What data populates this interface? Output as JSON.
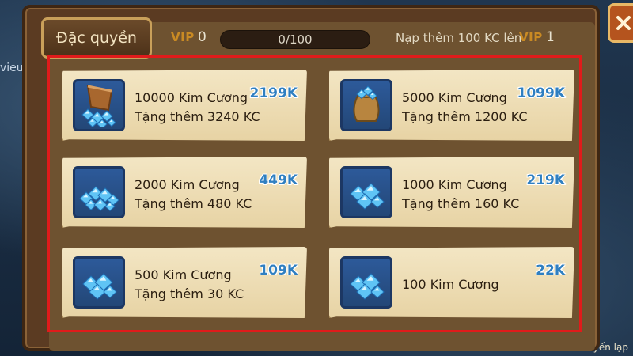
{
  "background": {
    "left_text": "vieu",
    "right_text": "yến lạp"
  },
  "header": {
    "privilege_label": "Đặc quyền",
    "vip_label": "VIP",
    "vip_current": "0",
    "progress_text": "0/100",
    "progress_fraction": 0,
    "topup_note": "Nạp thêm 100 KC lên",
    "vip_next": "1"
  },
  "packages": [
    {
      "title": "10000 Kim Cương",
      "bonus": "Tặng thêm 3240 KC",
      "price": "2199K",
      "icon": "gem-bucket-icon"
    },
    {
      "title": "5000 Kim Cương",
      "bonus": "Tặng thêm 1200 KC",
      "price": "1099K",
      "icon": "gem-sack-icon"
    },
    {
      "title": "2000 Kim Cương",
      "bonus": "Tặng thêm 480 KC",
      "price": "449K",
      "icon": "gem-pile-icon"
    },
    {
      "title": "1000 Kim Cương",
      "bonus": "Tặng thêm 160 KC",
      "price": "219K",
      "icon": "gem-cluster-icon"
    },
    {
      "title": "500 Kim Cương",
      "bonus": "Tặng thêm 30 KC",
      "price": "109K",
      "icon": "gem-cluster-icon"
    },
    {
      "title": "100 Kim Cương",
      "bonus": "",
      "price": "22K",
      "icon": "gem-cluster-icon"
    }
  ],
  "colors": {
    "highlight": "#e01b1b",
    "price": "#2f7fc1",
    "card": "#f3e6c4",
    "panel": "#6e5230"
  }
}
